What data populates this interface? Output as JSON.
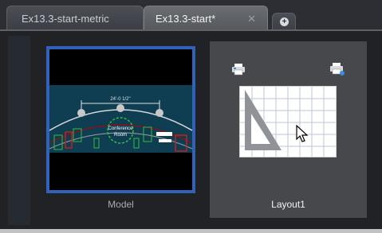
{
  "tabs": [
    {
      "label": "Ex13.3-start-metric",
      "active": false
    },
    {
      "label": "Ex13.3-start*",
      "active": true,
      "close_glyph": "✕"
    }
  ],
  "new_tab_glyph": "+",
  "model": {
    "label": "Model",
    "drawing_text": {
      "dimension": "24'-0 1/2\"",
      "room_name_line1": "Conference",
      "room_name_line2": "Room"
    }
  },
  "layout": {
    "label": "Layout1"
  },
  "icons": {
    "close": "close-icon",
    "add_tab": "plus-icon",
    "page_setup": "printer-icon",
    "plot": "printer-icon",
    "cursor": "mouse-pointer-icon"
  },
  "colors": {
    "active_border": "#2f62b8",
    "background": "#202226",
    "card": "#46484c"
  }
}
